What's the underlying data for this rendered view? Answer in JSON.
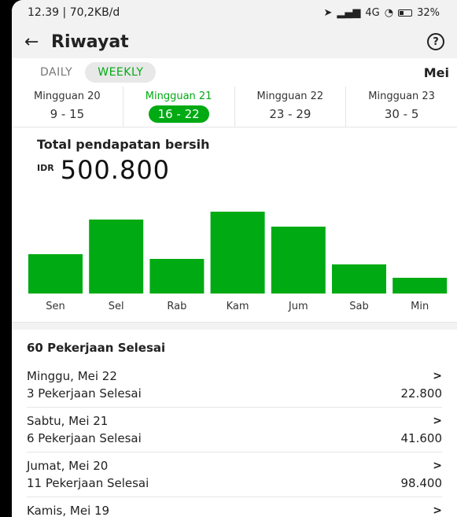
{
  "status": {
    "time": "12.39",
    "speed": "70,2KB/d",
    "network": "4G",
    "battery": "32%"
  },
  "header": {
    "title": "Riwayat"
  },
  "tabs": [
    {
      "label": "DAILY"
    },
    {
      "label": "WEEKLY"
    }
  ],
  "month": "Mei",
  "weeks": [
    {
      "label": "Mingguan 20",
      "range": "9 - 15"
    },
    {
      "label": "Mingguan 21",
      "range": "16 - 22"
    },
    {
      "label": "Mingguan 22",
      "range": "23 - 29"
    },
    {
      "label": "Mingguan 23",
      "range": "30 - 5"
    }
  ],
  "earnings": {
    "label": "Total pendapatan bersih",
    "currency": "IDR",
    "amount": "500.800"
  },
  "chart_data": {
    "type": "bar",
    "categories": [
      "Sen",
      "Sel",
      "Rab",
      "Kam",
      "Jum",
      "Sab",
      "Min"
    ],
    "values": [
      50,
      94,
      44,
      104,
      85,
      37,
      20
    ],
    "ylim": [
      0,
      104
    ],
    "color": "#00aa13"
  },
  "jobs": {
    "title": "60 Pekerjaan Selesai",
    "items": [
      {
        "day": "Minggu, Mei 22",
        "count": "3 Pekerjaan Selesai",
        "value": "22.800"
      },
      {
        "day": "Sabtu, Mei 21",
        "count": "6 Pekerjaan Selesai",
        "value": "41.600"
      },
      {
        "day": "Jumat, Mei 20",
        "count": "11 Pekerjaan Selesai",
        "value": "98.400"
      },
      {
        "day": "Kamis, Mei 19",
        "count": "",
        "value": ""
      }
    ]
  },
  "icons": {
    "back": "arrow-left-icon",
    "help": "question-circle-icon",
    "chevron": "chevron-right-icon"
  },
  "colors": {
    "accent": "#00aa13"
  }
}
